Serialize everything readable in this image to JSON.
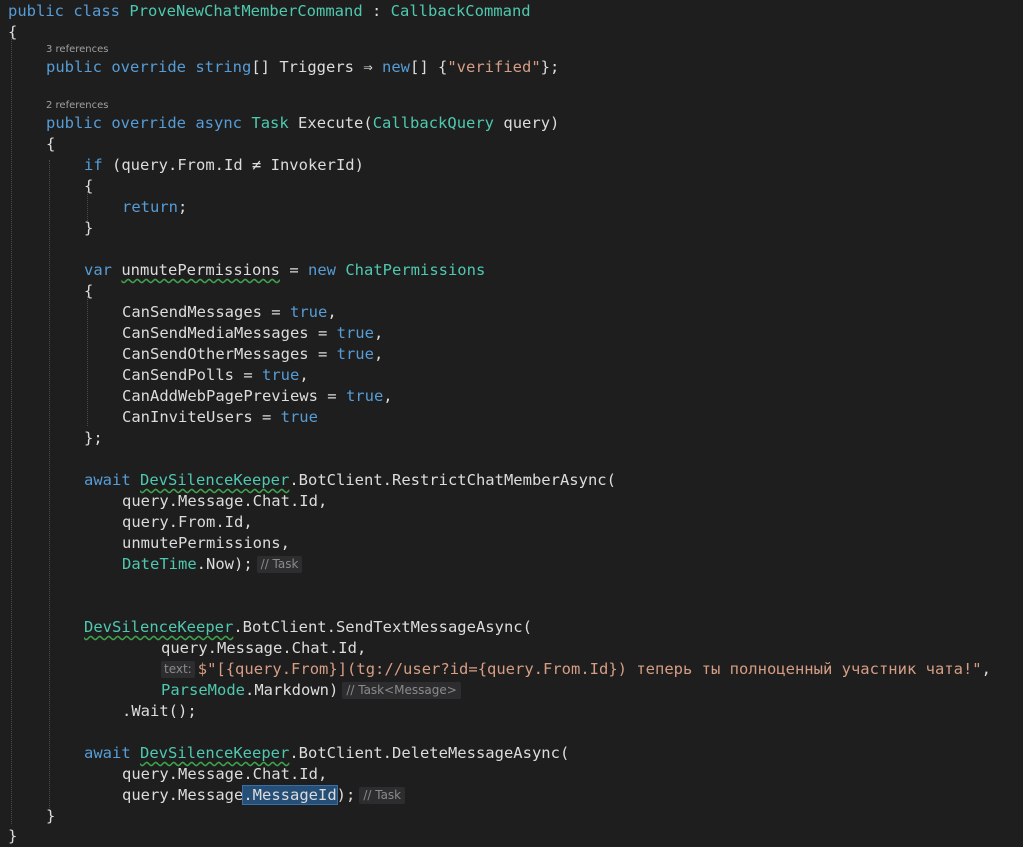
{
  "codelens": {
    "triggers_refs": "3 references",
    "execute_refs": "2 references"
  },
  "tokens": {
    "l1_public": "public",
    "l1_class": "class",
    "l1_name": "ProveNewChatMemberCommand",
    "l1_colon": " : ",
    "l1_base": "CallbackCommand",
    "l2_brace": "{",
    "l3_public": "public",
    "l3_override": "override",
    "l3_string": "string",
    "l3_rest": "[] Triggers ⇒ ",
    "l3_new": "new",
    "l3_arr": "[] {",
    "l3_str": "\"verified\"",
    "l3_end": "};",
    "l4_public": "public",
    "l4_override": "override",
    "l4_async": "async",
    "l4_task": "Task",
    "l4_execute": "Execute",
    "l4_open": "(",
    "l4_cbq": "CallbackQuery",
    "l4_param": " query)",
    "l5_brace": "{",
    "l6_if": "if",
    "l6_cond": " (query.From.Id ≠ InvokerId)",
    "l7_brace": "{",
    "l8_return": "return",
    "l8_semi": ";",
    "l9_brace": "}",
    "l10_var": "var",
    "l10_name": "unmutePermissions",
    "l10_eq": " = ",
    "l10_new": "new",
    "l10_type": "ChatPermissions",
    "l11_brace": "{",
    "l12_prop": "CanSendMessages = ",
    "l12_true": "true",
    "l12_comma": ",",
    "l13_prop": "CanSendMediaMessages = ",
    "l13_true": "true",
    "l13_comma": ",",
    "l14_prop": "CanSendOtherMessages = ",
    "l14_true": "true",
    "l14_comma": ",",
    "l15_prop": "CanSendPolls = ",
    "l15_true": "true",
    "l15_comma": ",",
    "l16_prop": "CanAddWebPagePreviews = ",
    "l16_true": "true",
    "l16_comma": ",",
    "l17_prop": "CanInviteUsers = ",
    "l17_true": "true",
    "l18_end": "};",
    "l19_await": "await",
    "l19_cls": "DevSilenceKeeper",
    "l19_rest": ".BotClient.",
    "l19_method": "RestrictChatMemberAsync",
    "l19_open": "(",
    "l20_text": "query.Message.Chat.Id,",
    "l21_text": "query.From.Id,",
    "l22_text": "unmutePermissions,",
    "l23_dt": "DateTime",
    "l23_rest": ".Now);",
    "l23_hint": "// Task",
    "l24_cls": "DevSilenceKeeper",
    "l24_rest": ".BotClient.",
    "l24_method": "SendTextMessageAsync",
    "l24_open": "(",
    "l25_text": "query.Message.Chat.Id,",
    "l26_param": "text:",
    "l26_str": "$\"[{query.From}](tg://user?id={query.From.Id}) теперь ты полноценный участник чата!\"",
    "l26_comma": ",",
    "l27_pm": "ParseMode",
    "l27_rest": ".Markdown)",
    "l27_hint": "// Task<Message>",
    "l28_dot": ".",
    "l28_wait": "Wait",
    "l28_end": "();",
    "l29_await": "await",
    "l29_cls": "DevSilenceKeeper",
    "l29_rest": ".BotClient.",
    "l29_method": "DeleteMessageAsync",
    "l29_open": "(",
    "l30_text": "query.Message.Chat.Id,",
    "l31_pre": "query.Message",
    "l31_sel": ".MessageId",
    "l31_end": ");",
    "l31_hint": "// Task",
    "l32_brace": "}",
    "l33_brace": "}"
  }
}
